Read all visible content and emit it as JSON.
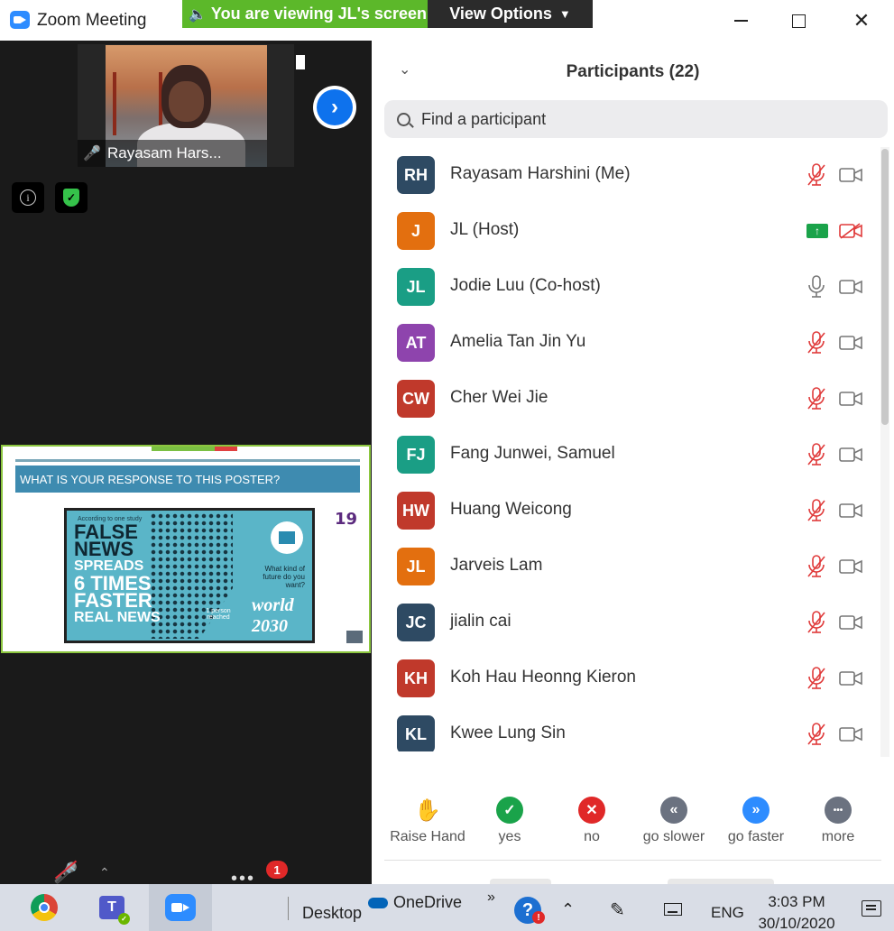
{
  "window": {
    "app_title": "Zoom Meeting",
    "viewing_banner": "You are viewing JL's screen",
    "view_options": "View Options"
  },
  "video": {
    "thumb_name": "Rayasam Hars...",
    "chat_badge": "1"
  },
  "shared_screen": {
    "header": "WHAT IS YOUR RESPONSE TO THIS POSTER?",
    "slide_number": "19",
    "poster_small": "According to one study",
    "poster_line1": "FALSE",
    "poster_line2": "NEWS",
    "poster_line3": "SPREADS",
    "poster_line4": "6 TIMES",
    "poster_line5": "FASTER",
    "poster_line6": "REAL NEWS",
    "poster_question": "What kind of future do you want?",
    "poster_world": "world 2030",
    "poster_reached": "1 person reached"
  },
  "panel": {
    "title": "Participants (22)",
    "search_placeholder": "Find a participant"
  },
  "participants": [
    {
      "initials": "RH",
      "name": "Rayasam Harshini (Me)",
      "color": "#2e4a63",
      "mic": "muted",
      "cam": "off-grey"
    },
    {
      "initials": "J",
      "name": "JL (Host)",
      "color": "#e36f0f",
      "mic": "sharing",
      "cam": "off-red"
    },
    {
      "initials": "JL",
      "name": "Jodie Luu (Co-host)",
      "color": "#1a9e85",
      "mic": "on",
      "cam": "off-grey"
    },
    {
      "initials": "AT",
      "name": "Amelia Tan Jin Yu",
      "color": "#8e44ad",
      "mic": "muted",
      "cam": "off-grey"
    },
    {
      "initials": "CW",
      "name": "Cher Wei Jie",
      "color": "#c0392b",
      "mic": "muted",
      "cam": "off-grey"
    },
    {
      "initials": "FJ",
      "name": "Fang Junwei, Samuel",
      "color": "#1a9e85",
      "mic": "muted",
      "cam": "off-grey"
    },
    {
      "initials": "HW",
      "name": "Huang Weicong",
      "color": "#c0392b",
      "mic": "muted",
      "cam": "off-grey"
    },
    {
      "initials": "JL",
      "name": "Jarveis Lam",
      "color": "#e36f0f",
      "mic": "muted",
      "cam": "off-grey"
    },
    {
      "initials": "JC",
      "name": "jialin cai",
      "color": "#2e4a63",
      "mic": "muted",
      "cam": "off-grey"
    },
    {
      "initials": "KH",
      "name": "Koh Hau Heonng Kieron",
      "color": "#c0392b",
      "mic": "muted",
      "cam": "off-grey"
    },
    {
      "initials": "KL",
      "name": "Kwee Lung Sin",
      "color": "#2e4a63",
      "mic": "muted",
      "cam": "off-grey"
    }
  ],
  "reactions": [
    {
      "label": "Raise Hand",
      "icon": "raise-hand-icon",
      "color": "#2d8cff"
    },
    {
      "label": "yes",
      "icon": "check-icon",
      "color": "#1aa34a"
    },
    {
      "label": "no",
      "icon": "x-icon",
      "color": "#e02828"
    },
    {
      "label": "go slower",
      "icon": "rewind-icon",
      "color": "#6b7280"
    },
    {
      "label": "go faster",
      "icon": "fast-forward-icon",
      "color": "#2d8cff"
    },
    {
      "label": "more",
      "icon": "more-icon",
      "color": "#6b7280"
    }
  ],
  "taskbar": {
    "desktop": "Desktop",
    "onedrive": "OneDrive",
    "lang": "ENG",
    "time": "3:03 PM",
    "date": "30/10/2020"
  }
}
